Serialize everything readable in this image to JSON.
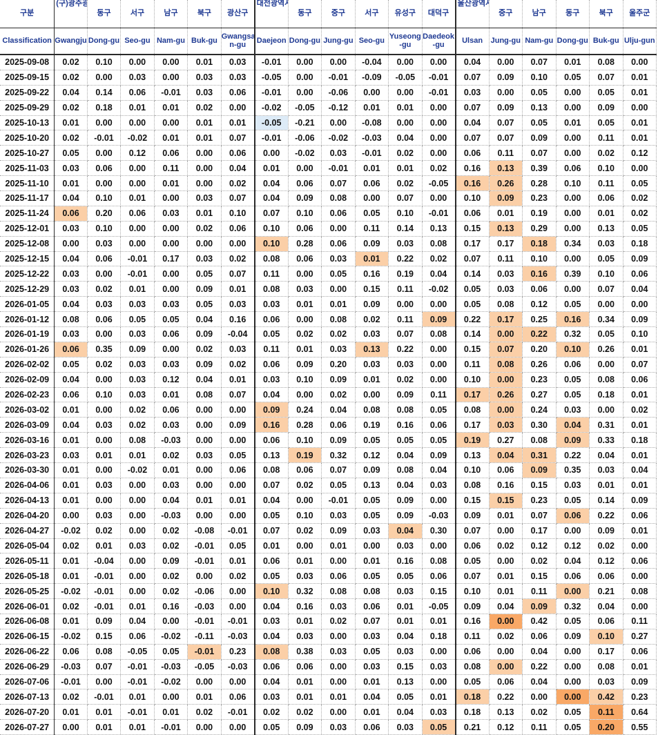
{
  "colors": {
    "header_text": "#1f3a93",
    "highlight_light": "#fbcfa7",
    "highlight_strong": "#f9a866",
    "highlight_blue": "#ddebf7"
  },
  "header": {
    "kr": [
      "구분",
      "(구)광주광",
      "동구",
      "서구",
      "남구",
      "북구",
      "광산구",
      "대전광역시",
      "동구",
      "중구",
      "서구",
      "유성구",
      "대덕구",
      "울산광역시",
      "중구",
      "남구",
      "동구",
      "북구",
      "울주군"
    ],
    "en": [
      "Classification",
      "Gwangju",
      "Dong-gu",
      "Seo-gu",
      "Nam-gu",
      "Buk-gu",
      "Gwangsa n-gu",
      "Daejeon",
      "Dong-gu",
      "Jung-gu",
      "Seo-gu",
      "Yuseong -gu",
      "Daedeok -gu",
      "Ulsan",
      "Jung-gu",
      "Nam-gu",
      "Dong-gu",
      "Buk-gu",
      "Ulju-gun"
    ]
  },
  "rows": [
    {
      "date": "2025-09-08",
      "values": [
        "0.02",
        "0.10",
        "0.00",
        "0.00",
        "0.01",
        "0.03",
        "-0.01",
        "0.00",
        "0.00",
        "-0.04",
        "0.00",
        "0.00",
        "0.04",
        "0.00",
        "0.07",
        "0.01",
        "0.08",
        "0.00"
      ],
      "hl": {}
    },
    {
      "date": "2025-09-15",
      "values": [
        "0.02",
        "0.00",
        "0.03",
        "0.00",
        "0.03",
        "0.03",
        "-0.05",
        "0.00",
        "-0.01",
        "-0.09",
        "-0.05",
        "-0.01",
        "0.07",
        "0.09",
        "0.10",
        "0.05",
        "0.07",
        "0.01"
      ],
      "hl": {}
    },
    {
      "date": "2025-09-22",
      "values": [
        "0.04",
        "0.14",
        "0.06",
        "-0.01",
        "0.03",
        "0.06",
        "-0.01",
        "0.00",
        "-0.06",
        "0.00",
        "0.00",
        "-0.01",
        "0.03",
        "0.00",
        "0.05",
        "0.00",
        "0.05",
        "0.01"
      ],
      "hl": {}
    },
    {
      "date": "2025-09-29",
      "values": [
        "0.02",
        "0.18",
        "0.01",
        "0.01",
        "0.02",
        "0.00",
        "-0.02",
        "-0.05",
        "-0.12",
        "0.01",
        "0.01",
        "0.00",
        "0.07",
        "0.09",
        "0.13",
        "0.00",
        "0.09",
        "0.00"
      ],
      "hl": {}
    },
    {
      "date": "2025-10-13",
      "values": [
        "0.01",
        "0.00",
        "0.00",
        "0.00",
        "0.01",
        "0.01",
        "-0.05",
        "-0.21",
        "0.00",
        "-0.08",
        "0.00",
        "0.00",
        "0.04",
        "0.07",
        "0.05",
        "0.01",
        "0.05",
        "0.01"
      ],
      "hl": {
        "7": "hb"
      }
    },
    {
      "date": "2025-10-20",
      "values": [
        "0.02",
        "-0.01",
        "-0.02",
        "0.01",
        "0.01",
        "0.07",
        "-0.01",
        "-0.06",
        "-0.02",
        "-0.03",
        "0.04",
        "0.00",
        "0.07",
        "0.07",
        "0.09",
        "0.00",
        "0.11",
        "0.01"
      ],
      "hl": {}
    },
    {
      "date": "2025-10-27",
      "values": [
        "0.05",
        "0.00",
        "0.12",
        "0.06",
        "0.00",
        "0.06",
        "0.00",
        "-0.02",
        "0.03",
        "-0.01",
        "0.02",
        "0.00",
        "0.06",
        "0.11",
        "0.07",
        "0.00",
        "0.02",
        "0.12"
      ],
      "hl": {}
    },
    {
      "date": "2025-11-03",
      "values": [
        "0.03",
        "0.06",
        "0.00",
        "0.11",
        "0.00",
        "0.04",
        "0.01",
        "0.00",
        "-0.01",
        "0.01",
        "0.01",
        "0.02",
        "0.16",
        "0.13",
        "0.39",
        "0.06",
        "0.10",
        "0.00"
      ],
      "hl": {
        "14": "h1"
      }
    },
    {
      "date": "2025-11-10",
      "values": [
        "0.01",
        "0.00",
        "0.00",
        "0.01",
        "0.00",
        "0.02",
        "0.04",
        "0.06",
        "0.07",
        "0.06",
        "0.02",
        "-0.05",
        "0.16",
        "0.26",
        "0.28",
        "0.10",
        "0.11",
        "0.05"
      ],
      "hl": {
        "13": "h1",
        "14": "h1"
      }
    },
    {
      "date": "2025-11-17",
      "values": [
        "0.04",
        "0.10",
        "0.01",
        "0.00",
        "0.03",
        "0.07",
        "0.04",
        "0.09",
        "0.08",
        "0.00",
        "0.07",
        "0.00",
        "0.10",
        "0.09",
        "0.23",
        "0.00",
        "0.06",
        "0.02"
      ],
      "hl": {
        "14": "h1"
      }
    },
    {
      "date": "2025-11-24",
      "values": [
        "0.06",
        "0.20",
        "0.06",
        "0.03",
        "0.01",
        "0.10",
        "0.07",
        "0.10",
        "0.06",
        "0.05",
        "0.10",
        "-0.01",
        "0.06",
        "0.01",
        "0.19",
        "0.00",
        "0.01",
        "0.02"
      ],
      "hl": {
        "1": "h1"
      }
    },
    {
      "date": "2025-12-01",
      "values": [
        "0.03",
        "0.10",
        "0.00",
        "0.00",
        "0.02",
        "0.06",
        "0.10",
        "0.06",
        "0.00",
        "0.11",
        "0.14",
        "0.13",
        "0.15",
        "0.13",
        "0.29",
        "0.00",
        "0.13",
        "0.05"
      ],
      "hl": {
        "14": "h1"
      }
    },
    {
      "date": "2025-12-08",
      "values": [
        "0.00",
        "0.03",
        "0.00",
        "0.00",
        "0.00",
        "0.00",
        "0.10",
        "0.28",
        "0.06",
        "0.09",
        "0.03",
        "0.08",
        "0.17",
        "0.17",
        "0.18",
        "0.34",
        "0.03",
        "0.18"
      ],
      "hl": {
        "7": "h1",
        "15": "h1"
      }
    },
    {
      "date": "2025-12-15",
      "values": [
        "0.04",
        "0.06",
        "-0.01",
        "0.17",
        "0.03",
        "0.02",
        "0.08",
        "0.06",
        "0.03",
        "0.01",
        "0.22",
        "0.02",
        "0.07",
        "0.11",
        "0.10",
        "0.00",
        "0.05",
        "0.09"
      ],
      "hl": {
        "10": "h1"
      }
    },
    {
      "date": "2025-12-22",
      "values": [
        "0.03",
        "0.00",
        "-0.01",
        "0.00",
        "0.05",
        "0.07",
        "0.11",
        "0.00",
        "0.05",
        "0.16",
        "0.19",
        "0.04",
        "0.14",
        "0.03",
        "0.16",
        "0.39",
        "0.10",
        "0.06"
      ],
      "hl": {
        "15": "h1"
      }
    },
    {
      "date": "2025-12-29",
      "values": [
        "0.03",
        "0.02",
        "0.01",
        "0.00",
        "0.09",
        "0.01",
        "0.08",
        "0.03",
        "0.00",
        "0.15",
        "0.11",
        "-0.02",
        "0.05",
        "0.03",
        "0.06",
        "0.00",
        "0.07",
        "0.04"
      ],
      "hl": {}
    },
    {
      "date": "2026-01-05",
      "values": [
        "0.04",
        "0.03",
        "0.03",
        "0.03",
        "0.05",
        "0.03",
        "0.03",
        "0.01",
        "0.01",
        "0.09",
        "0.00",
        "0.00",
        "0.05",
        "0.08",
        "0.12",
        "0.05",
        "0.00",
        "0.00"
      ],
      "hl": {}
    },
    {
      "date": "2026-01-12",
      "values": [
        "0.08",
        "0.06",
        "0.05",
        "0.05",
        "0.04",
        "0.16",
        "0.06",
        "0.00",
        "0.08",
        "0.02",
        "0.11",
        "0.09",
        "0.22",
        "0.17",
        "0.25",
        "0.16",
        "0.34",
        "0.09"
      ],
      "hl": {
        "12": "h1",
        "14": "h1",
        "16": "h1"
      }
    },
    {
      "date": "2026-01-19",
      "values": [
        "0.03",
        "0.00",
        "0.03",
        "0.06",
        "0.09",
        "-0.04",
        "0.05",
        "0.02",
        "0.02",
        "0.03",
        "0.07",
        "0.08",
        "0.14",
        "0.00",
        "0.22",
        "0.32",
        "0.05",
        "0.10"
      ],
      "hl": {
        "14": "h1",
        "15": "h1"
      }
    },
    {
      "date": "2026-01-26",
      "values": [
        "0.06",
        "0.35",
        "0.09",
        "0.00",
        "0.02",
        "0.03",
        "0.11",
        "0.01",
        "0.03",
        "0.13",
        "0.22",
        "0.00",
        "0.15",
        "0.07",
        "0.20",
        "0.10",
        "0.26",
        "0.01"
      ],
      "hl": {
        "1": "h1",
        "10": "h1",
        "14": "h1",
        "16": "h1"
      }
    },
    {
      "date": "2026-02-02",
      "values": [
        "0.05",
        "0.02",
        "0.03",
        "0.03",
        "0.09",
        "0.02",
        "0.06",
        "0.09",
        "0.20",
        "0.03",
        "0.03",
        "0.00",
        "0.11",
        "0.08",
        "0.26",
        "0.06",
        "0.00",
        "0.07"
      ],
      "hl": {
        "14": "h1"
      }
    },
    {
      "date": "2026-02-09",
      "values": [
        "0.04",
        "0.00",
        "0.03",
        "0.12",
        "0.04",
        "0.01",
        "0.03",
        "0.10",
        "0.09",
        "0.01",
        "0.02",
        "0.00",
        "0.10",
        "0.00",
        "0.23",
        "0.05",
        "0.08",
        "0.06"
      ],
      "hl": {
        "14": "h1"
      }
    },
    {
      "date": "2026-02-23",
      "values": [
        "0.06",
        "0.10",
        "0.03",
        "0.01",
        "0.08",
        "0.07",
        "0.04",
        "0.00",
        "0.02",
        "0.00",
        "0.09",
        "0.11",
        "0.17",
        "0.26",
        "0.27",
        "0.05",
        "0.18",
        "0.01"
      ],
      "hl": {
        "13": "h1",
        "14": "h1"
      }
    },
    {
      "date": "2026-03-02",
      "values": [
        "0.01",
        "0.00",
        "0.02",
        "0.06",
        "0.00",
        "0.00",
        "0.09",
        "0.24",
        "0.04",
        "0.08",
        "0.08",
        "0.05",
        "0.08",
        "0.00",
        "0.24",
        "0.03",
        "0.00",
        "0.02"
      ],
      "hl": {
        "7": "h1",
        "14": "h1"
      }
    },
    {
      "date": "2026-03-09",
      "values": [
        "0.04",
        "0.03",
        "0.02",
        "0.03",
        "0.00",
        "0.09",
        "0.16",
        "0.28",
        "0.06",
        "0.19",
        "0.16",
        "0.06",
        "0.17",
        "0.03",
        "0.30",
        "0.04",
        "0.31",
        "0.01"
      ],
      "hl": {
        "7": "h1",
        "14": "h1",
        "16": "h1"
      }
    },
    {
      "date": "2026-03-16",
      "values": [
        "0.01",
        "0.00",
        "0.08",
        "-0.03",
        "0.00",
        "0.00",
        "0.06",
        "0.10",
        "0.09",
        "0.05",
        "0.05",
        "0.05",
        "0.19",
        "0.27",
        "0.08",
        "0.09",
        "0.33",
        "0.18"
      ],
      "hl": {
        "13": "h1",
        "16": "h1"
      }
    },
    {
      "date": "2026-03-23",
      "values": [
        "0.03",
        "0.01",
        "0.01",
        "0.02",
        "0.03",
        "0.05",
        "0.13",
        "0.19",
        "0.32",
        "0.12",
        "0.04",
        "0.09",
        "0.13",
        "0.04",
        "0.31",
        "0.22",
        "0.04",
        "0.01"
      ],
      "hl": {
        "8": "h1",
        "14": "h1",
        "15": "h1"
      }
    },
    {
      "date": "2026-03-30",
      "values": [
        "0.01",
        "0.00",
        "-0.02",
        "0.01",
        "0.00",
        "0.06",
        "0.08",
        "0.06",
        "0.07",
        "0.09",
        "0.08",
        "0.04",
        "0.10",
        "0.06",
        "0.09",
        "0.35",
        "0.03",
        "0.04"
      ],
      "hl": {
        "15": "h1"
      }
    },
    {
      "date": "2026-04-06",
      "values": [
        "0.01",
        "0.03",
        "0.00",
        "0.03",
        "0.00",
        "0.00",
        "0.07",
        "0.02",
        "0.05",
        "0.13",
        "0.04",
        "0.03",
        "0.08",
        "0.16",
        "0.15",
        "0.03",
        "0.01",
        "0.01"
      ],
      "hl": {}
    },
    {
      "date": "2026-04-13",
      "values": [
        "0.01",
        "0.00",
        "0.00",
        "0.04",
        "0.01",
        "0.01",
        "0.04",
        "0.00",
        "-0.01",
        "0.05",
        "0.09",
        "0.00",
        "0.15",
        "0.15",
        "0.23",
        "0.05",
        "0.14",
        "0.09"
      ],
      "hl": {
        "14": "h1"
      }
    },
    {
      "date": "2026-04-20",
      "values": [
        "0.00",
        "0.03",
        "0.00",
        "-0.03",
        "0.00",
        "0.00",
        "0.05",
        "0.10",
        "0.03",
        "0.05",
        "0.09",
        "-0.03",
        "0.09",
        "0.01",
        "0.07",
        "0.06",
        "0.22",
        "0.06"
      ],
      "hl": {
        "16": "h1"
      }
    },
    {
      "date": "2026-04-27",
      "values": [
        "-0.02",
        "0.02",
        "0.00",
        "0.02",
        "-0.08",
        "-0.01",
        "0.07",
        "0.02",
        "0.09",
        "0.03",
        "0.04",
        "0.30",
        "0.07",
        "0.00",
        "0.17",
        "0.00",
        "0.09",
        "0.01"
      ],
      "hl": {
        "11": "h1"
      }
    },
    {
      "date": "2026-05-04",
      "values": [
        "0.02",
        "0.01",
        "0.03",
        "0.02",
        "-0.01",
        "0.05",
        "0.01",
        "0.00",
        "0.01",
        "0.00",
        "0.03",
        "0.00",
        "0.06",
        "0.02",
        "0.12",
        "0.12",
        "0.02",
        "0.00"
      ],
      "hl": {}
    },
    {
      "date": "2026-05-11",
      "values": [
        "0.01",
        "-0.04",
        "0.00",
        "0.09",
        "-0.01",
        "0.01",
        "0.06",
        "0.01",
        "0.00",
        "0.01",
        "0.16",
        "0.08",
        "0.05",
        "0.00",
        "0.02",
        "0.04",
        "0.12",
        "0.06"
      ],
      "hl": {}
    },
    {
      "date": "2026-05-18",
      "values": [
        "0.01",
        "-0.01",
        "0.00",
        "0.02",
        "0.00",
        "0.02",
        "0.05",
        "0.03",
        "0.06",
        "0.05",
        "0.05",
        "0.06",
        "0.07",
        "0.01",
        "0.15",
        "0.06",
        "0.06",
        "0.00"
      ],
      "hl": {}
    },
    {
      "date": "2026-05-25",
      "values": [
        "-0.02",
        "-0.01",
        "0.00",
        "0.02",
        "-0.06",
        "0.00",
        "0.10",
        "0.32",
        "0.08",
        "0.08",
        "0.03",
        "0.15",
        "0.10",
        "0.01",
        "0.11",
        "0.00",
        "0.21",
        "0.08"
      ],
      "hl": {
        "7": "h1",
        "16": "h1"
      }
    },
    {
      "date": "2026-06-01",
      "values": [
        "0.02",
        "-0.01",
        "0.01",
        "0.16",
        "-0.03",
        "0.00",
        "0.04",
        "0.16",
        "0.03",
        "0.06",
        "0.01",
        "-0.05",
        "0.09",
        "0.04",
        "0.09",
        "0.32",
        "0.04",
        "0.00"
      ],
      "hl": {
        "15": "h1"
      }
    },
    {
      "date": "2026-06-08",
      "values": [
        "0.01",
        "0.09",
        "0.04",
        "0.00",
        "-0.01",
        "-0.01",
        "0.03",
        "0.01",
        "0.02",
        "0.07",
        "0.01",
        "0.01",
        "0.16",
        "0.00",
        "0.42",
        "0.05",
        "0.06",
        "0.11"
      ],
      "hl": {
        "14": "h2"
      }
    },
    {
      "date": "2026-06-15",
      "values": [
        "-0.02",
        "0.15",
        "0.06",
        "-0.02",
        "-0.11",
        "-0.03",
        "0.04",
        "0.03",
        "0.00",
        "0.03",
        "0.04",
        "0.18",
        "0.11",
        "0.02",
        "0.06",
        "0.09",
        "0.10",
        "0.27"
      ],
      "hl": {
        "17": "h1"
      }
    },
    {
      "date": "2026-06-22",
      "values": [
        "0.06",
        "0.08",
        "-0.05",
        "0.05",
        "-0.01",
        "0.23",
        "0.08",
        "0.38",
        "0.03",
        "0.05",
        "0.03",
        "0.00",
        "0.06",
        "0.00",
        "0.04",
        "0.00",
        "0.17",
        "0.06"
      ],
      "hl": {
        "5": "h1",
        "7": "h1"
      }
    },
    {
      "date": "2026-06-29",
      "values": [
        "-0.03",
        "0.07",
        "-0.01",
        "-0.03",
        "-0.05",
        "-0.03",
        "0.06",
        "0.06",
        "0.00",
        "0.03",
        "0.15",
        "0.03",
        "0.08",
        "0.00",
        "0.22",
        "0.00",
        "0.08",
        "0.01"
      ],
      "hl": {
        "14": "h1"
      }
    },
    {
      "date": "2026-07-06",
      "values": [
        "-0.01",
        "0.00",
        "-0.01",
        "-0.02",
        "0.00",
        "0.00",
        "0.04",
        "0.01",
        "0.00",
        "0.01",
        "0.13",
        "0.00",
        "0.05",
        "0.06",
        "0.04",
        "0.00",
        "0.03",
        "0.09"
      ],
      "hl": {}
    },
    {
      "date": "2026-07-13",
      "values": [
        "0.02",
        "-0.01",
        "0.01",
        "0.00",
        "0.01",
        "0.06",
        "0.03",
        "0.01",
        "0.01",
        "0.04",
        "0.05",
        "0.01",
        "0.18",
        "0.22",
        "0.00",
        "0.00",
        "0.42",
        "0.23"
      ],
      "hl": {
        "13": "h1",
        "16": "h2",
        "17": "h1"
      }
    },
    {
      "date": "2026-07-20",
      "values": [
        "0.01",
        "0.01",
        "-0.01",
        "0.01",
        "0.02",
        "-0.01",
        "0.02",
        "0.02",
        "0.00",
        "0.01",
        "0.04",
        "0.03",
        "0.18",
        "0.13",
        "0.02",
        "0.05",
        "0.11",
        "0.64"
      ],
      "hl": {
        "17": "h2"
      }
    },
    {
      "date": "2026-07-27",
      "values": [
        "0.00",
        "0.01",
        "0.01",
        "-0.01",
        "0.00",
        "0.00",
        "0.05",
        "0.09",
        "0.03",
        "0.06",
        "0.03",
        "0.05",
        "0.21",
        "0.12",
        "0.11",
        "0.05",
        "0.20",
        "0.55"
      ],
      "hl": {
        "12": "h1",
        "17": "h2"
      }
    }
  ]
}
